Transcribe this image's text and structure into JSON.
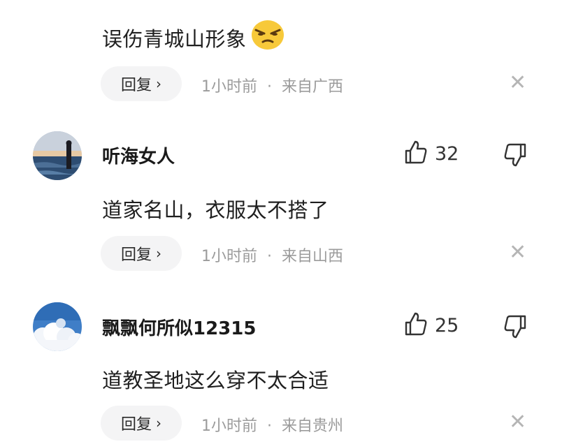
{
  "comments": [
    {
      "text": "误伤青城山形象",
      "emoji": "smirk-emoji",
      "reply_label": "回复",
      "time": "1小时前",
      "location": "来自广西"
    },
    {
      "username": "听海女人",
      "likes": "32",
      "text": "道家名山，衣服太不搭了",
      "reply_label": "回复",
      "time": "1小时前",
      "location": "来自山西"
    },
    {
      "username": "飘飘何所似12315",
      "likes": "25",
      "text": "道教圣地这么穿不太合适",
      "reply_label": "回复",
      "time": "1小时前",
      "location": "来自贵州"
    }
  ],
  "icons": {
    "like": "thumbs-up-icon",
    "dislike": "thumbs-down-icon",
    "close": "close-icon",
    "chevron": "chevron-right-icon"
  }
}
